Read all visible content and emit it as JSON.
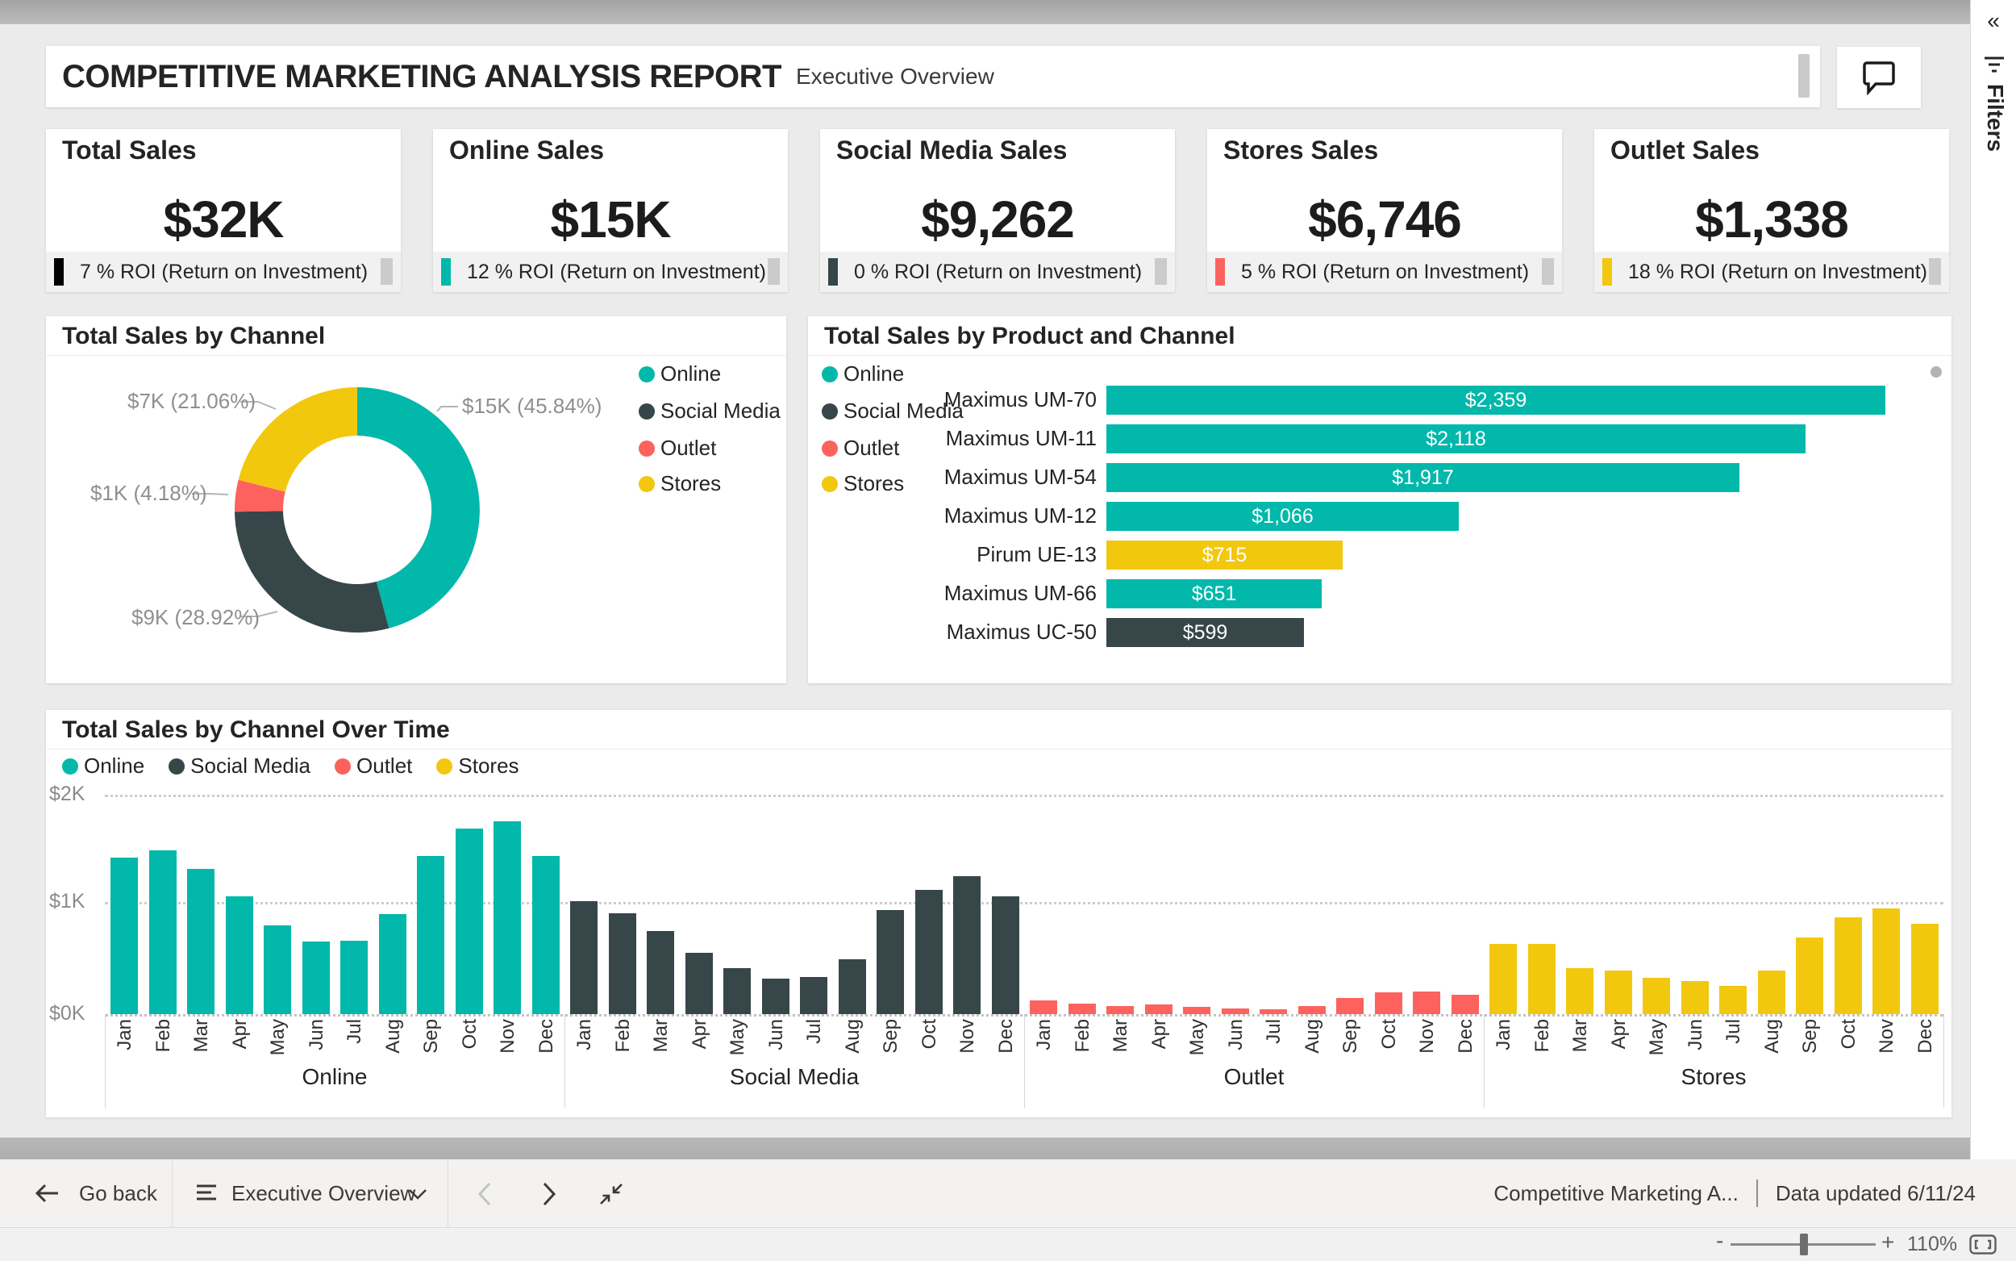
{
  "header": {
    "title": "COMPETITIVE MARKETING ANALYSIS REPORT",
    "subtitle": "Executive Overview"
  },
  "filters_pane": {
    "title": "Filters"
  },
  "channels": [
    "Online",
    "Social Media",
    "Outlet",
    "Stores"
  ],
  "channel_colors": {
    "Online": "#01B8AA",
    "Social Media": "#374649",
    "Outlet": "#FD625E",
    "Stores": "#F2C80F"
  },
  "kpi_cards": [
    {
      "title": "Total Sales",
      "value": "$32K",
      "roi_text": "7 % ROI (Return on Investment)",
      "accent": "#000000"
    },
    {
      "title": "Online Sales",
      "value": "$15K",
      "roi_text": "12 % ROI (Return on Investment)",
      "accent": "#01B8AA"
    },
    {
      "title": "Social Media Sales",
      "value": "$9,262",
      "roi_text": "0 % ROI (Return on Investment)",
      "accent": "#374649"
    },
    {
      "title": "Stores Sales",
      "value": "$6,746",
      "roi_text": "5 % ROI (Return on Investment)",
      "accent": "#FD625E"
    },
    {
      "title": "Outlet Sales",
      "value": "$1,338",
      "roi_text": "18 % ROI (Return on Investment)",
      "accent": "#F2C80F"
    }
  ],
  "chart_data": [
    {
      "type": "pie",
      "title": "Total Sales by Channel",
      "labels": [
        "Online",
        "Social Media",
        "Outlet",
        "Stores"
      ],
      "values_k": [
        15,
        9,
        1,
        7
      ],
      "percents": [
        45.84,
        28.92,
        4.18,
        21.06
      ],
      "data_labels": [
        "$15K (45.84%)",
        "$9K (28.92%)",
        "$1K (4.18%)",
        "$7K (21.06%)"
      ],
      "legend_position": "right",
      "donut": true
    },
    {
      "type": "bar",
      "title": "Total Sales by Product and Channel",
      "orientation": "horizontal",
      "categories": [
        "Maximus UM-70",
        "Maximus UM-11",
        "Maximus UM-54",
        "Maximus UM-12",
        "Pirum UE-13",
        "Maximus UM-66",
        "Maximus UC-50"
      ],
      "values": [
        2359,
        2118,
        1917,
        1066,
        715,
        651,
        599
      ],
      "bar_channel": [
        "Online",
        "Online",
        "Online",
        "Online",
        "Stores",
        "Online",
        "Social Media"
      ],
      "data_labels": [
        "$2,359",
        "$2,118",
        "$1,917",
        "$1,066",
        "$715",
        "$651",
        "$599"
      ],
      "legend": [
        "Online",
        "Social Media",
        "Outlet",
        "Stores"
      ],
      "legend_position": "left"
    },
    {
      "type": "bar",
      "title": "Total Sales by Channel Over Time",
      "grouped_by": "channel",
      "x": [
        "Jan",
        "Feb",
        "Mar",
        "Apr",
        "May",
        "Jun",
        "Jul",
        "Aug",
        "Sep",
        "Oct",
        "Nov",
        "Dec"
      ],
      "group_labels": [
        "Online",
        "Social Media",
        "Outlet",
        "Stores"
      ],
      "series": [
        {
          "name": "Online",
          "values": [
            1430,
            1490,
            1320,
            1070,
            810,
            660,
            670,
            910,
            1440,
            1690,
            1760,
            1440
          ]
        },
        {
          "name": "Social Media",
          "values": [
            1030,
            920,
            760,
            560,
            420,
            320,
            340,
            500,
            950,
            1130,
            1260,
            1070
          ]
        },
        {
          "name": "Outlet",
          "values": [
            125,
            95,
            75,
            90,
            65,
            55,
            45,
            75,
            145,
            200,
            205,
            180
          ]
        },
        {
          "name": "Stores",
          "values": [
            640,
            640,
            420,
            400,
            330,
            300,
            260,
            400,
            700,
            880,
            960,
            820
          ]
        }
      ],
      "y_ticks": [
        "$0K",
        "$1K",
        "$2K"
      ],
      "ylim": [
        0,
        2000
      ],
      "grid": "dotted",
      "legend_position": "top"
    }
  ],
  "navbar": {
    "go_back": "Go back",
    "page_selector": "Executive Overview",
    "report_title": "Competitive Marketing A...",
    "data_updated": "Data updated 6/11/24"
  },
  "zoombar": {
    "zoom_level": "110%"
  }
}
